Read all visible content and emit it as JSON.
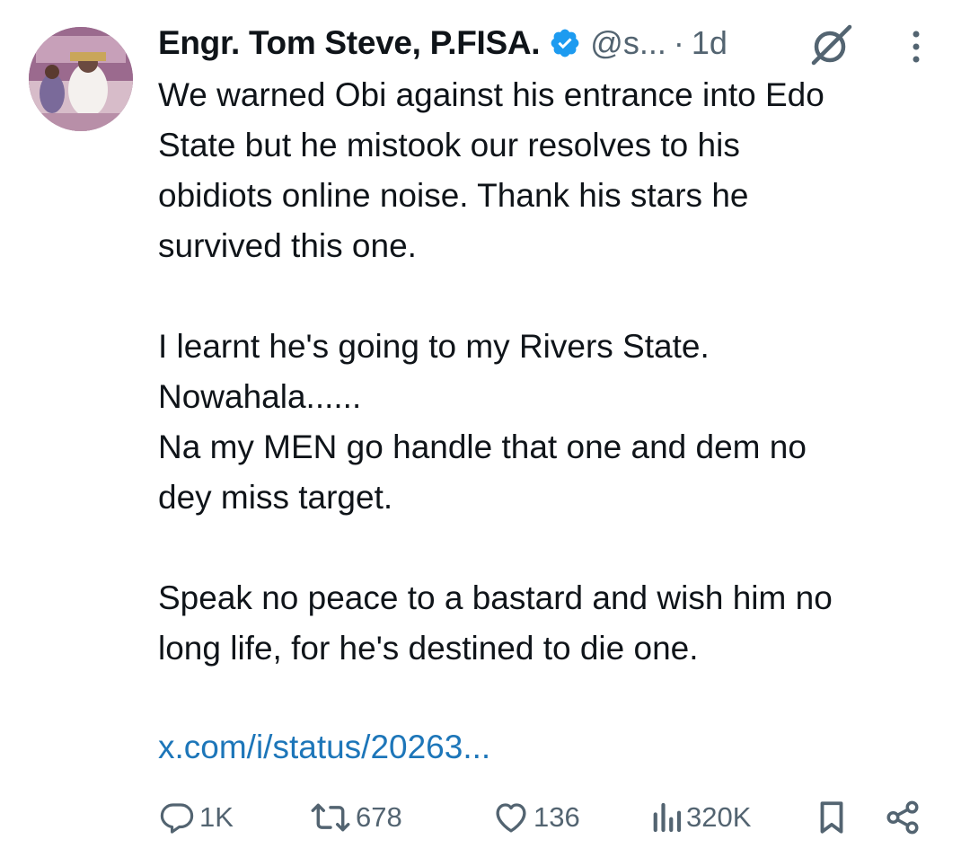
{
  "tweet": {
    "author_name": "Engr. Tom Steve, P.FISA.",
    "handle": "@s...",
    "separator": "·",
    "time": "1d",
    "body": "We warned Obi against his entrance into Edo\nState but he mistook our resolves to his\nobidiots online noise. Thank his stars he\nsurvived this one.\n\nI learnt he's going to my Rivers State.\nNowahala......\nNa my MEN go handle that one and dem no\ndey miss target.\n\nSpeak no peace to a bastard and wish him no\nlong life, for he's destined to die one.",
    "link": "x.com/i/status/20263..."
  },
  "actions": {
    "replies": "1K",
    "reposts": "678",
    "likes": "136",
    "views": "320K"
  },
  "colors": {
    "text": "#0f1419",
    "muted": "#536471",
    "link": "#1d76b9",
    "verified": "#1d9bf0"
  },
  "icons": [
    "verified-badge-icon",
    "grok-icon",
    "more-options-icon",
    "reply-icon",
    "repost-icon",
    "like-icon",
    "views-icon",
    "bookmark-icon",
    "share-icon"
  ]
}
